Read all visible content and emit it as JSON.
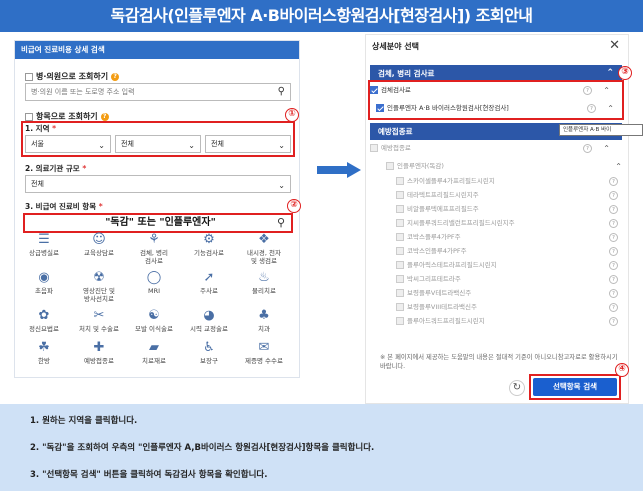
{
  "banner": {
    "title": "독감검사(인플루엔자 A·B바이러스항원검사[현장검사]) 조회안내"
  },
  "left_panel": {
    "header": "비급여 진료비용 상세 검색",
    "hospital_search": {
      "label": "병·의원으로 조회하기",
      "placeholder": "병·의원 이름 또는 도로명 주소 입력"
    },
    "item_search": {
      "label": "항목으로 조회하기"
    },
    "region": {
      "label": "1. 지역",
      "required": "*",
      "values": [
        "서울",
        "전체",
        "전체"
      ]
    },
    "institution_size": {
      "label": "2. 의료기관 규모",
      "required": "*",
      "value": "전체"
    },
    "item": {
      "label": "3. 비급여 진료비 항목",
      "required": "*",
      "search_text": "\"독감\"  또는  \"인플루엔자\""
    },
    "categories": [
      {
        "label": "상급병실료",
        "icon": "bed-icon"
      },
      {
        "label": "교육상담료",
        "icon": "consult-icon"
      },
      {
        "label": "검체, 병리\n검사료",
        "icon": "test-tube-icon"
      },
      {
        "label": "기능검사료",
        "icon": "function-test-icon"
      },
      {
        "label": "내시경, 천자\n및 생검료",
        "icon": "endoscope-icon"
      },
      {
        "label": "초음파",
        "icon": "ultrasound-icon"
      },
      {
        "label": "영상진단 및\n방사선치료",
        "icon": "radiology-icon"
      },
      {
        "label": "MRI",
        "icon": "mri-icon"
      },
      {
        "label": "주사료",
        "icon": "syringe-icon"
      },
      {
        "label": "물리치료",
        "icon": "physio-icon"
      },
      {
        "label": "정신요법료",
        "icon": "brain-icon"
      },
      {
        "label": "처치 및 수술료",
        "icon": "surgery-icon"
      },
      {
        "label": "모발 이식술료",
        "icon": "hair-icon"
      },
      {
        "label": "시력 교정술료",
        "icon": "eye-icon"
      },
      {
        "label": "치과",
        "icon": "tooth-icon"
      },
      {
        "label": "한방",
        "icon": "herbal-icon"
      },
      {
        "label": "예방접종료",
        "icon": "vaccine-icon"
      },
      {
        "label": "치료재료",
        "icon": "material-icon"
      },
      {
        "label": "보장구",
        "icon": "aid-icon"
      },
      {
        "label": "제증명 수수료",
        "icon": "certificate-icon"
      }
    ]
  },
  "right_panel": {
    "title": "상세분야 선택",
    "section1": {
      "header": "검체, 병리 검사료",
      "group": "검체검사료",
      "item": "인플루엔자 A·B 바이러스항원검사[현장검사]"
    },
    "tooltip": "인플루엔자 A·B 바이",
    "section2": {
      "header": "예방접종료",
      "group": "예방접종료",
      "subgroup": "인플루엔자(독감)",
      "items": [
        "스카이셀플루4가프리필드시린지",
        "테라텍트프리필드시린지주",
        "비알플루텍에프프리필드주",
        "지씨플루쿼드리밸런트프리필드시린지주",
        "코박스플루4가PF주",
        "코박스인플루4가PF주",
        "플루아릭스테트라프리필드시린지",
        "박씨그리프테트라주",
        "보령플루V테트라백신주",
        "보령플루VIII테트라백신주",
        "플루아드쿼드프리필드시린지"
      ]
    },
    "note": "※ 본 페이지에서 제공하는 도움말의 내용은 절대적 기준이 아니오니참고자료로 활용하시기 바랍니다.",
    "search_button": "선택항목 검색"
  },
  "markers": [
    "①",
    "②",
    "③",
    "④"
  ],
  "instructions": [
    "1. 원하는 지역을 클릭합니다.",
    "2. \"독감\"을 조회하여 우측의 \"인플루엔자 A,B바이러스 항원검사[현장검사]항목을 클릭합니다.",
    "3. \"선택항목 검색\" 버튼을 클릭하여 독감검사 항목을 확인합니다."
  ],
  "colors": {
    "banner": "#2f6fc6",
    "section_header": "#2c57a8",
    "highlight": "#e02020",
    "instruction_bg": "#cfe1f6",
    "button": "#1a5fcf"
  }
}
